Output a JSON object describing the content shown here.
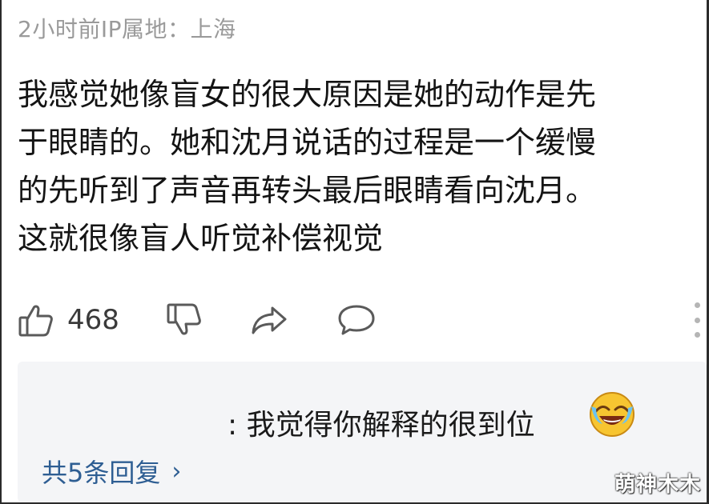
{
  "comment": {
    "meta": "2小时前IP属地：上海",
    "lines": [
      "我感觉她像盲女的很大原因是她的动作是先",
      "于眼睛的。她和沈月说话的过程是一个缓慢",
      "的先听到了声音再转头最后眼睛看向沈月。",
      "这就很像盲人听觉补偿视觉"
    ]
  },
  "actions": {
    "like_count": "468",
    "like_icon": "thumbs-up-icon",
    "dislike_icon": "thumbs-down-icon",
    "share_icon": "share-icon",
    "reply_icon": "comment-icon",
    "more_icon": "more-vertical-icon"
  },
  "reply": {
    "text": ": 我觉得你解释的很到位",
    "emoji": "laughing-crying-emoji",
    "count_label": "共5条回复",
    "chevron": "›"
  },
  "watermark": "萌神木木",
  "colors": {
    "link": "#2e5e93",
    "meta": "#9a9a9a",
    "reply_bg": "#f4f5f7"
  }
}
